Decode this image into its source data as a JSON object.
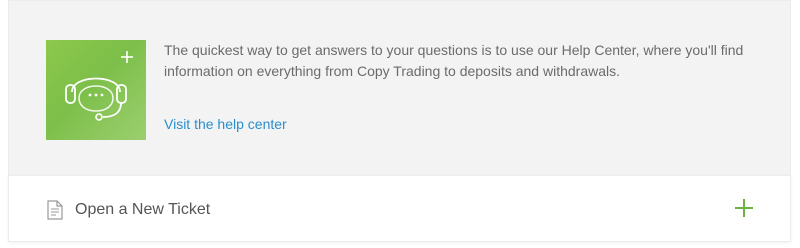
{
  "help": {
    "description": "The quickest way to get answers to your questions is to use our Help Center, where you'll find information on everything from Copy Trading to deposits and withdrawals.",
    "link_label": "Visit the help center",
    "illustration_icon": "headset-icon",
    "illustration_color": "#8cc84b"
  },
  "ticket": {
    "label": "Open a New Ticket",
    "leading_icon": "document-icon",
    "trailing_icon": "plus-icon",
    "accent_color": "#6cb33f"
  },
  "colors": {
    "link": "#2a8fce",
    "text": "#6b6b6b",
    "card_bg": "#f3f3f3"
  }
}
